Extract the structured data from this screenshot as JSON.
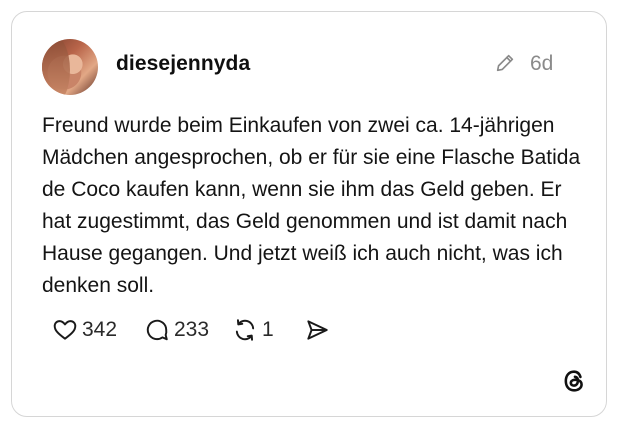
{
  "post": {
    "username": "diesejennyda",
    "time": "6d",
    "text": "Freund wurde beim Einkaufen von zwei ca. 14-jährigen Mädchen angesprochen, ob er für sie eine Flasche Batida de Coco kaufen kann, wenn sie ihm das Geld geben. Er hat zugestimmt, das Geld genommen und ist damit nach Hause gegangen. Und jetzt weiß ich auch nicht, was ich denken soll."
  },
  "actions": {
    "likes": "342",
    "comments": "233",
    "reposts": "1"
  },
  "icons": {
    "like": "heart-icon",
    "comment": "speech-bubble-icon",
    "repost": "repost-arrows-icon",
    "share": "send-icon",
    "edit": "pencil-icon",
    "brand": "threads-logo-icon"
  }
}
